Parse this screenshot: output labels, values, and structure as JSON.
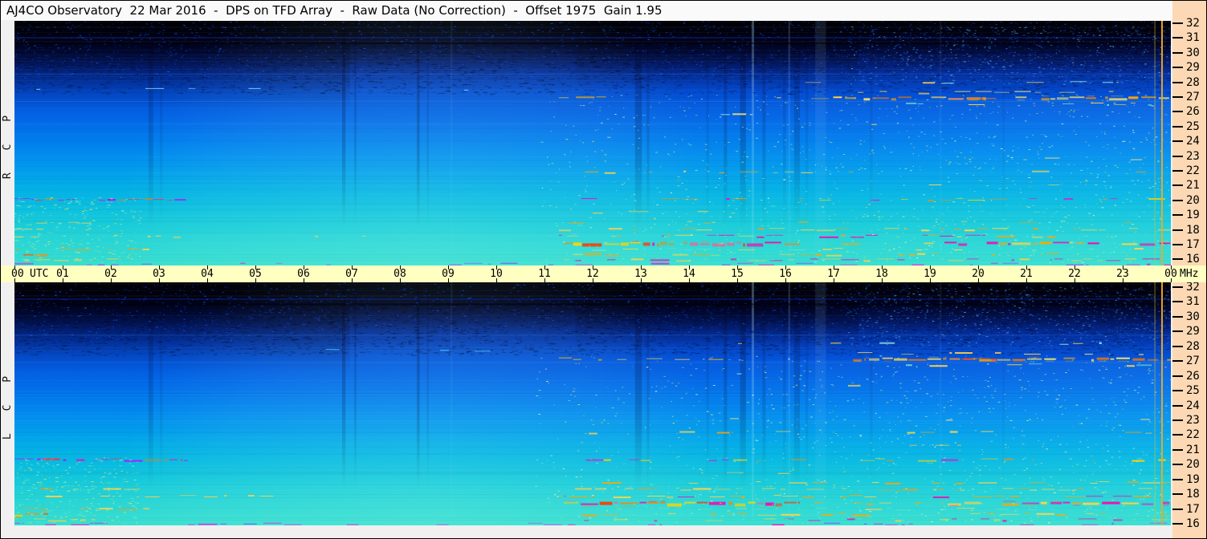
{
  "header": {
    "title": "AJ4CO Observatory  22 Mar 2016  -  DPS on TFD Array  -  Raw Data (No Correction)  -  Offset 1975  Gain 1.95"
  },
  "panels": [
    {
      "id": "rcp",
      "label": "R C P",
      "seed": 20160322
    },
    {
      "id": "lcp",
      "label": "L C P",
      "seed": 42160322
    }
  ],
  "time_axis": {
    "unit_left": "UTC",
    "unit_right": "MHz",
    "hour_labels": [
      "00",
      "01",
      "02",
      "03",
      "04",
      "05",
      "06",
      "07",
      "08",
      "09",
      "10",
      "11",
      "12",
      "13",
      "14",
      "15",
      "16",
      "17",
      "18",
      "19",
      "20",
      "21",
      "22",
      "23",
      "00"
    ]
  },
  "freq_axis": {
    "labels": [
      "32",
      "31",
      "30",
      "29",
      "28",
      "27",
      "26",
      "25",
      "24",
      "23",
      "22",
      "21",
      "20",
      "19",
      "18",
      "17",
      "16"
    ]
  },
  "colors": {
    "titlebar": "#fafafa",
    "cream_axis": "#ffffc2",
    "peach_axis": "#fcd9b4",
    "gutter": "#f0f0f0",
    "border": "#000000"
  },
  "chart_data": {
    "type": "heatmap",
    "title": "AJ4CO Observatory  22 Mar 2016  -  DPS on TFD Array  -  Raw Data (No Correction)  -  Offset 1975  Gain 1.95",
    "panels": [
      "RCP",
      "LCP"
    ],
    "x_axis": {
      "label": "UTC",
      "range_hours": [
        0,
        24
      ],
      "tick_step_hours": 1
    },
    "y_axis": {
      "label": "MHz",
      "range_mhz": [
        16,
        32
      ],
      "tick_step_mhz": 1,
      "inverted": true
    },
    "colormap": [
      [
        0.0,
        "#010103"
      ],
      [
        0.05,
        "#010107"
      ],
      [
        0.09,
        "#02041c"
      ],
      [
        0.13,
        "#041454"
      ],
      [
        0.17,
        "#062582"
      ],
      [
        0.21,
        "#0536ae"
      ],
      [
        0.27,
        "#0448cc"
      ],
      [
        0.33,
        "#0357dc"
      ],
      [
        0.4,
        "#0266e6"
      ],
      [
        0.47,
        "#0178ec"
      ],
      [
        0.54,
        "#018aee"
      ],
      [
        0.61,
        "#019cec"
      ],
      [
        0.68,
        "#02aee6"
      ],
      [
        0.75,
        "#08bce0"
      ],
      [
        0.82,
        "#16cada"
      ],
      [
        0.9,
        "#28d5d5"
      ],
      [
        1.0,
        "#38dfd0"
      ]
    ],
    "shading": [
      {
        "type": "v",
        "rect": [
          0,
          0,
          1,
          0.3
        ],
        "stops": [
          [
            0,
            "rgba(0,0,5,0.95)"
          ],
          [
            0.3,
            "rgba(0,4,35,0.55)"
          ],
          [
            0.65,
            "rgba(0,12,70,0.25)"
          ],
          [
            1,
            "rgba(0,20,90,0)"
          ]
        ]
      },
      {
        "type": "v",
        "rect": [
          0,
          0,
          0.29,
          0.37
        ],
        "stops": [
          [
            0,
            "rgba(0,0,4,0.60)"
          ],
          [
            0.55,
            "rgba(0,3,35,0.25)"
          ],
          [
            1,
            "rgba(0,6,55,0)"
          ]
        ]
      },
      {
        "type": "v",
        "rect": [
          0.485,
          0,
          0.73,
          0.27
        ],
        "stops": [
          [
            0,
            "rgba(0,0,4,0.50)"
          ],
          [
            0.6,
            "rgba(0,2,25,0.20)"
          ],
          [
            1,
            "rgba(0,4,40,0)"
          ]
        ]
      },
      {
        "type": "radial",
        "cx": 0.355,
        "cy": 0.99,
        "r": 0.27,
        "stops": [
          [
            0,
            "rgba(170,255,242,0.17)"
          ],
          [
            0.7,
            "rgba(170,255,242,0.07)"
          ],
          [
            1,
            "rgba(170,255,242,0)"
          ]
        ]
      },
      {
        "type": "h",
        "rect": [
          0.45,
          0.32,
          1,
          1
        ],
        "stops": [
          [
            0,
            "rgba(140,240,255,0)"
          ],
          [
            1,
            "rgba(140,240,255,0.08)"
          ]
        ]
      }
    ],
    "vertical_bands": [
      {
        "t": 2.78,
        "w": 0.1,
        "a": 0.2
      },
      {
        "t": 3.02,
        "w": 0.05,
        "a": 0.12
      },
      {
        "t": 6.8,
        "w": 0.07,
        "a": 0.26
      },
      {
        "t": 7.05,
        "w": 0.05,
        "a": 0.16
      },
      {
        "t": 8.35,
        "w": 0.06,
        "a": 0.24
      },
      {
        "t": 8.56,
        "w": 0.04,
        "a": 0.13
      },
      {
        "t": 12.88,
        "w": 0.14,
        "a": 0.24
      },
      {
        "t": 13.12,
        "w": 0.06,
        "a": 0.15
      },
      {
        "t": 14.36,
        "w": 0.05,
        "a": 0.11
      },
      {
        "t": 14.72,
        "w": 0.07,
        "a": 0.2
      },
      {
        "t": 15.06,
        "w": 0.12,
        "a": 0.26
      },
      {
        "t": 15.52,
        "w": 0.07,
        "a": 0.17
      },
      {
        "t": 15.95,
        "w": 0.06,
        "a": 0.13
      },
      {
        "t": 16.18,
        "w": 0.12,
        "a": 0.2
      },
      {
        "t": 16.42,
        "w": 0.05,
        "a": 0.11
      },
      {
        "t": 17.75,
        "w": 0.06,
        "a": 0.09
      },
      {
        "t": 20.5,
        "w": 0.05,
        "a": 0.07
      }
    ],
    "light_bands": [
      {
        "t": 15.3,
        "w": 0.05,
        "l": 0.3
      },
      {
        "t": 16.62,
        "w": 0.22,
        "l": 0.1
      },
      {
        "t": 16.06,
        "w": 0.04,
        "l": 0.16
      },
      {
        "t": 19.2,
        "w": 0.04,
        "l": 0.07
      },
      {
        "t": 9.05,
        "w": 0.04,
        "l": 0.07
      }
    ],
    "calibration_lines": [
      {
        "t": 23.66,
        "w": 1,
        "color": "#d8c830",
        "alpha": 0.55
      },
      {
        "t": 23.8,
        "w": 2,
        "color": "#f0a820",
        "alpha": 0.95
      }
    ],
    "streaks": [
      {
        "f": 30.92,
        "t0": 0,
        "t1": 24,
        "solid": true,
        "w": 1,
        "alpha": 0.55,
        "colors": [
          "#1638d8"
        ]
      },
      {
        "f": 30.6,
        "t0": 0,
        "t1": 24,
        "solid": true,
        "w": 2,
        "alpha": 0.55,
        "colors": [
          "#00000a"
        ]
      },
      {
        "f": 28.55,
        "t0": 0,
        "t1": 24,
        "solid": true,
        "w": 1,
        "alpha": 0.28,
        "colors": [
          "#3c8cf4"
        ]
      },
      {
        "f": 26.75,
        "t0": 0,
        "t1": 24,
        "solid": true,
        "w": 1,
        "alpha": 0.16,
        "colors": [
          "#64c8ff"
        ]
      },
      {
        "f": 27.55,
        "t0": 0.1,
        "t1": 10.5,
        "d": 0.1,
        "w": 1,
        "colors": [
          "#55c8ff",
          "#90e8ff"
        ]
      },
      {
        "f": 27.0,
        "t0": 11.3,
        "t1": 17.4,
        "d": 0.28,
        "w": 2,
        "colors": [
          "#ffd24a",
          "#ffb300"
        ]
      },
      {
        "f": 27.0,
        "t0": 17.4,
        "t1": 24,
        "d": 0.85,
        "w": 3,
        "colors": [
          "#ffd24a",
          "#ffa400",
          "#ff7800",
          "#ffe76a"
        ]
      },
      {
        "f": 26.95,
        "t0": 19.4,
        "t1": 20.4,
        "d": 0.85,
        "w": 2,
        "colors": [
          "#ff4426",
          "#ff6a00"
        ]
      },
      {
        "f": 27.35,
        "t0": 17.5,
        "t1": 24,
        "d": 0.4,
        "w": 2,
        "colors": [
          "#ffd24a",
          "#ffe76a"
        ]
      },
      {
        "f": 26.6,
        "t0": 18.5,
        "t1": 24,
        "d": 0.33,
        "w": 2,
        "colors": [
          "#ffd24a",
          "#7fe5c8"
        ]
      },
      {
        "f": 28.0,
        "t0": 13.5,
        "t1": 24,
        "d": 0.2,
        "w": 2,
        "colors": [
          "#ffd24a",
          "#9ff0e0"
        ]
      },
      {
        "f": 25.95,
        "t0": 14.3,
        "t1": 16.3,
        "d": 0.22,
        "w": 2,
        "colors": [
          "#c8f2f2",
          "#ffe27a"
        ]
      },
      {
        "f": 25.3,
        "t0": 17.3,
        "t1": 17.9,
        "d": 0.45,
        "w": 2,
        "colors": [
          "#ffd24a"
        ]
      },
      {
        "f": 23.0,
        "t0": 13,
        "t1": 24,
        "d": 0.05,
        "w": 1,
        "colors": [
          "#ffe27a"
        ]
      },
      {
        "f": 22.15,
        "t0": 11.6,
        "t1": 24,
        "d": 0.3,
        "w": 2,
        "colors": [
          "#ffd24a",
          "#ffa400"
        ]
      },
      {
        "f": 21.35,
        "t0": 12.5,
        "t1": 24,
        "d": 0.13,
        "w": 1,
        "colors": [
          "#ffd24a"
        ]
      },
      {
        "f": 20.35,
        "t0": 0,
        "t1": 3.6,
        "d": 0.85,
        "w": 2,
        "colors": [
          "#ff00c8",
          "#ff2e4e",
          "#c400ff",
          "#ff7800"
        ]
      },
      {
        "f": 20.35,
        "t0": 11.5,
        "t1": 24,
        "d": 0.5,
        "w": 2,
        "colors": [
          "#ff00c8",
          "#ff8c00",
          "#ffd200"
        ]
      },
      {
        "f": 19.5,
        "t0": 12,
        "t1": 18,
        "d": 0.15,
        "w": 1,
        "colors": [
          "#ffd24a"
        ]
      },
      {
        "f": 18.85,
        "t0": 0,
        "t1": 1.6,
        "d": 0.38,
        "w": 2,
        "colors": [
          "#ffd24a"
        ]
      },
      {
        "f": 18.85,
        "t0": 11.5,
        "t1": 24,
        "d": 0.33,
        "w": 2,
        "colors": [
          "#ffd24a",
          "#ffa400"
        ]
      },
      {
        "f": 18.4,
        "t0": 0,
        "t1": 2.6,
        "d": 0.48,
        "w": 2,
        "colors": [
          "#ffd24a",
          "#ff9a00"
        ]
      },
      {
        "f": 18.4,
        "t0": 11.3,
        "t1": 24,
        "d": 0.52,
        "w": 2,
        "colors": [
          "#ffd24a",
          "#ff9a00"
        ]
      },
      {
        "f": 17.95,
        "t0": 0,
        "t1": 7.4,
        "d": 0.26,
        "w": 2,
        "colors": [
          "#ffd24a"
        ]
      },
      {
        "f": 17.95,
        "t0": 11.3,
        "t1": 24,
        "d": 0.58,
        "w": 2,
        "colors": [
          "#ffd24a",
          "#ffa400",
          "#ff00aa"
        ]
      },
      {
        "f": 17.5,
        "t0": 11.4,
        "t1": 16.3,
        "d": 0.95,
        "w": 4,
        "colors": [
          "#ff7f00",
          "#ff00aa",
          "#ffd200",
          "#ff3800",
          "#ff5a8c"
        ]
      },
      {
        "f": 17.5,
        "t0": 16.3,
        "t1": 19.3,
        "d": 0.5,
        "w": 2,
        "colors": [
          "#ffd24a",
          "#ffa400"
        ]
      },
      {
        "f": 17.5,
        "t0": 19.3,
        "t1": 24,
        "d": 0.8,
        "w": 3,
        "colors": [
          "#ffd24a",
          "#ffa400",
          "#ff00aa"
        ]
      },
      {
        "f": 17.1,
        "t0": 0,
        "t1": 2.8,
        "d": 0.6,
        "w": 2,
        "colors": [
          "#ffd24a",
          "#ff9a00"
        ]
      },
      {
        "f": 17.1,
        "t0": 11.4,
        "t1": 24,
        "d": 0.48,
        "w": 2,
        "colors": [
          "#ffd24a",
          "#64e0c8"
        ]
      },
      {
        "f": 16.75,
        "t0": 0,
        "t1": 0.7,
        "d": 0.85,
        "w": 3,
        "colors": [
          "#ff5a00",
          "#ff8c00",
          "#ffd200"
        ]
      },
      {
        "f": 16.75,
        "t0": 11.4,
        "t1": 24,
        "d": 0.42,
        "w": 2,
        "colors": [
          "#ffd24a",
          "#ffa400"
        ]
      },
      {
        "f": 16.4,
        "t0": 0,
        "t1": 2.2,
        "d": 0.48,
        "w": 2,
        "colors": [
          "#ffd24a"
        ]
      },
      {
        "f": 16.4,
        "t0": 11.4,
        "t1": 24,
        "d": 0.48,
        "w": 2,
        "colors": [
          "#ffd24a",
          "#ff00aa"
        ]
      },
      {
        "f": 16.12,
        "t0": 0,
        "t1": 24,
        "d": 0.42,
        "w": 2,
        "colors": [
          "#c83ce6",
          "#ff00c8",
          "#8c46ff"
        ]
      }
    ],
    "noise": {
      "top_specks": {
        "count": 2600,
        "depth": 0.24,
        "colors": [
          "#0030c0",
          "#0048e0",
          "#2060ff"
        ]
      },
      "dark_grain": {
        "count": 2600,
        "band": [
          0.09,
          0.3
        ]
      },
      "tr_specks": {
        "count": 700,
        "x0": 0.72,
        "band": [
          0.02,
          0.26
        ],
        "colors": [
          "#2060e0",
          "#40a0f0",
          "#70c8ff"
        ]
      },
      "bright_dots": {
        "count": 1500,
        "band": [
          0.3,
          0.99
        ],
        "colors": [
          "#e8e85a",
          "#a0f0d0",
          "#f8f8c0"
        ]
      },
      "left_dots": {
        "count": 260,
        "tmax": 2.6,
        "band": [
          0.72,
          0.99
        ],
        "colors": [
          "#e8e85a",
          "#90f0d0"
        ]
      },
      "row_band_prob": 0.1
    }
  }
}
